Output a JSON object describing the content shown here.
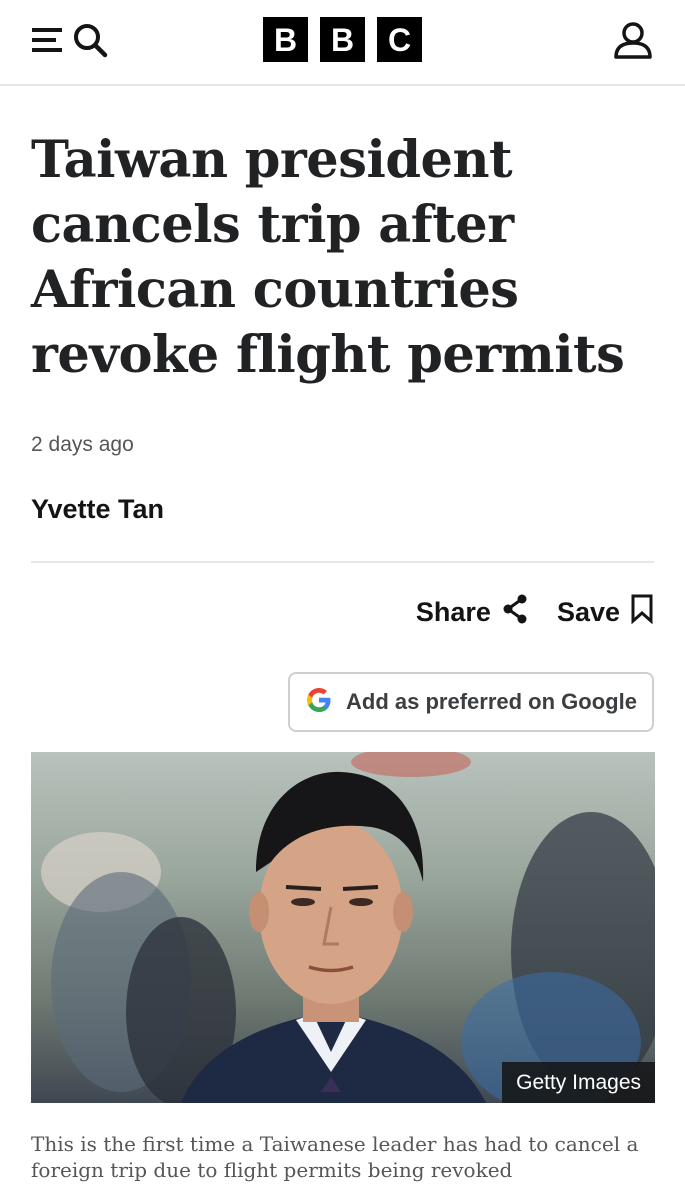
{
  "header": {
    "menu_icon": "menu-icon",
    "search_icon": "search-icon",
    "logo_letters": [
      "B",
      "B",
      "C"
    ],
    "account_icon": "account-icon"
  },
  "article": {
    "headline": "Taiwan president cancels trip after African countries revoke flight permits",
    "timestamp": "2 days ago",
    "author": "Yvette Tan",
    "share_label": "Share",
    "share_icon": "share-icon",
    "save_label": "Save",
    "save_icon": "bookmark-icon",
    "google_button_label": "Add as preferred on Google",
    "google_icon": "google-icon",
    "image_credit": "Getty Images",
    "caption": "This is the first time a Taiwanese leader has had to cancel a foreign trip due to flight permits being revoked"
  },
  "colors": {
    "logo_bg": "#000000",
    "text_primary": "#141414",
    "text_secondary": "#545658",
    "divider": "#e6e6e6"
  }
}
